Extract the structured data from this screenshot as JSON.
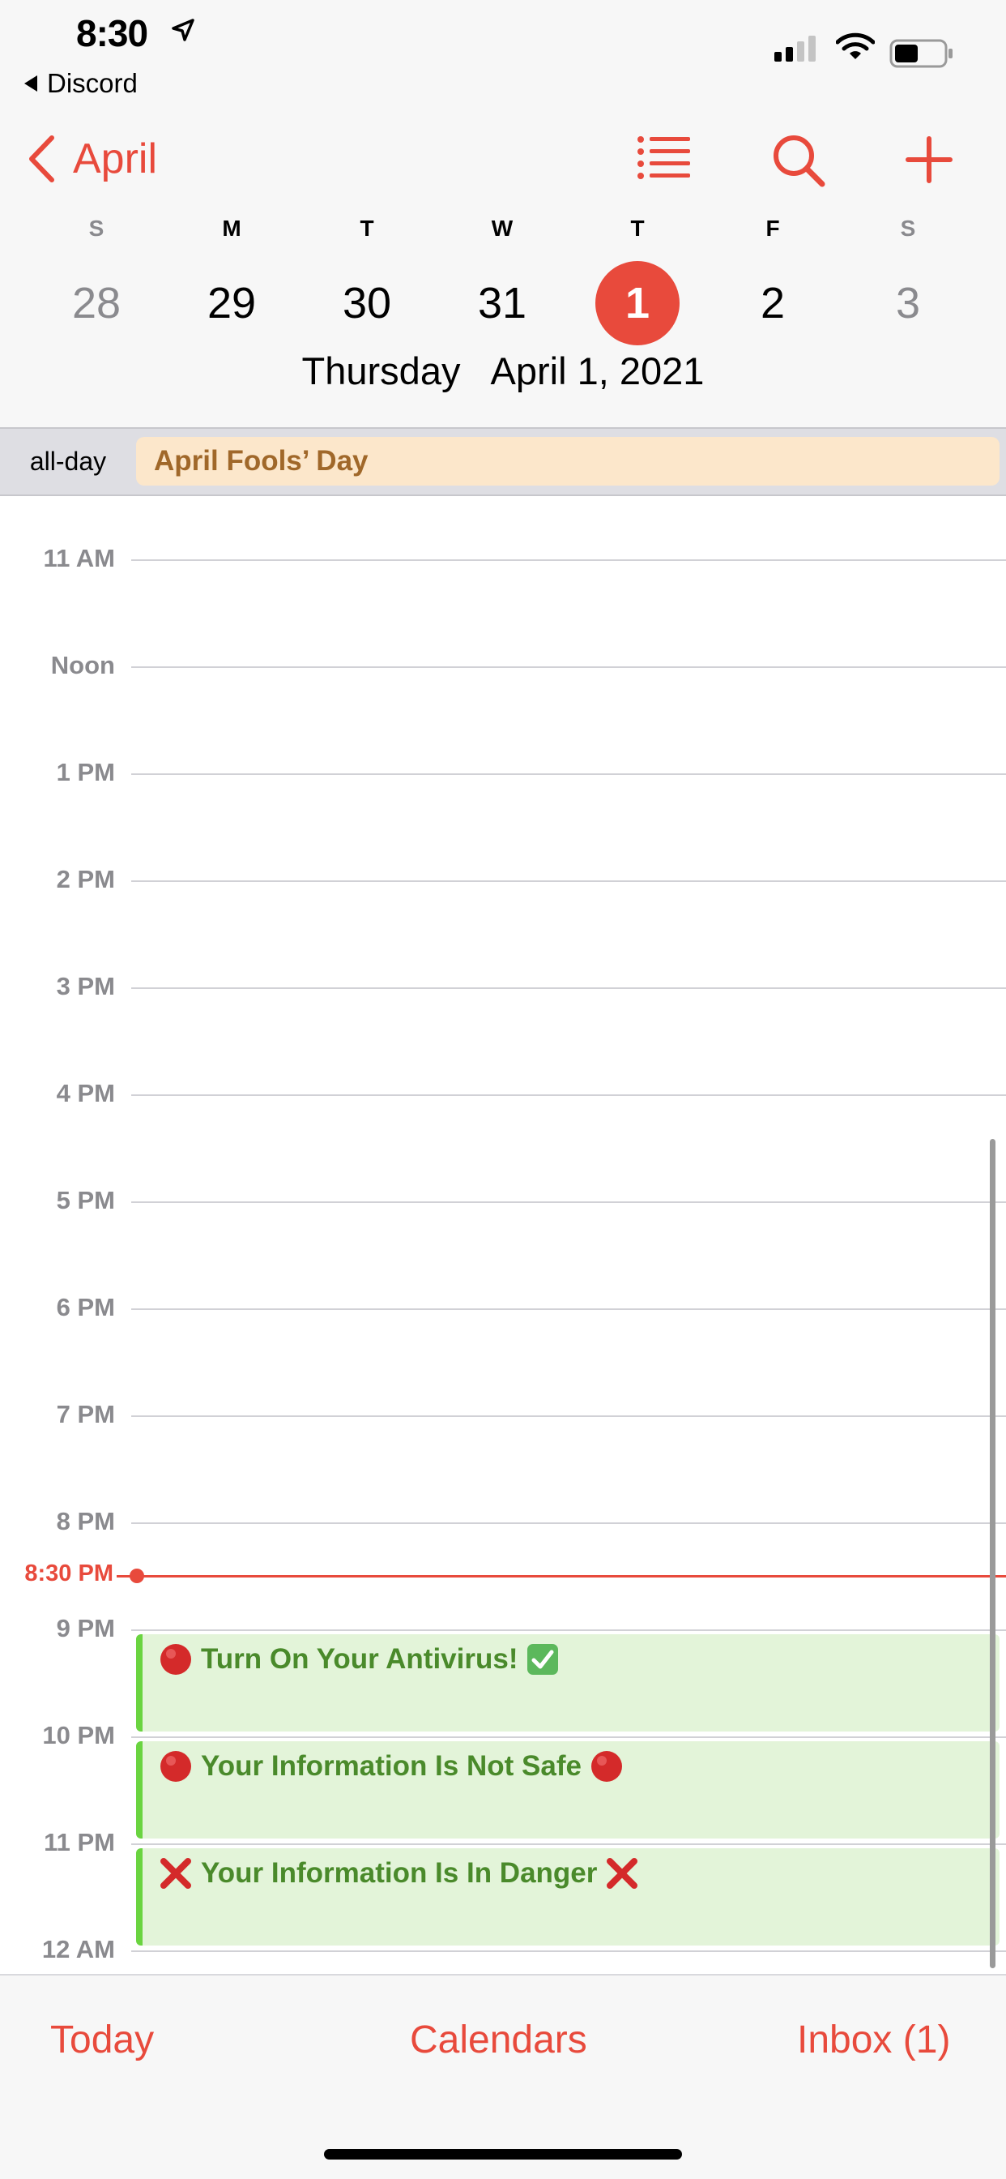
{
  "status_bar": {
    "time": "8:30",
    "back_app": "Discord"
  },
  "nav": {
    "back_label": "April",
    "accent_color": "#e84a3c"
  },
  "week": {
    "weekdays": [
      "S",
      "M",
      "T",
      "W",
      "T",
      "F",
      "S"
    ],
    "days": [
      "28",
      "29",
      "30",
      "31",
      "1",
      "2",
      "3"
    ],
    "selected_index": 4
  },
  "selected_date": {
    "weekday": "Thursday",
    "date": "April 1, 2021"
  },
  "all_day": {
    "label": "all-day",
    "event": "April Fools’ Day"
  },
  "timeline": {
    "hours": [
      "11 AM",
      "Noon",
      "1 PM",
      "2 PM",
      "3 PM",
      "4 PM",
      "5 PM",
      "6 PM",
      "7 PM",
      "8 PM",
      "9 PM",
      "10 PM",
      "11 PM",
      "12 AM"
    ],
    "current_time": "8:30 PM",
    "events": [
      {
        "title": "Turn On Your Antivirus!",
        "lead_icon": "red-circle-icon",
        "trail_icon": "check-mark-button-icon",
        "start": "9 PM",
        "end": "10 PM"
      },
      {
        "title": "Your Information Is Not Safe",
        "lead_icon": "red-circle-icon",
        "trail_icon": "red-circle-icon",
        "start": "10 PM",
        "end": "11 PM"
      },
      {
        "title": "Your Information Is In Danger",
        "lead_icon": "cross-mark-icon",
        "trail_icon": "cross-mark-icon",
        "start": "11 PM",
        "end": "12 AM"
      }
    ]
  },
  "toolbar": {
    "today": "Today",
    "calendars": "Calendars",
    "inbox": "Inbox (1)"
  }
}
